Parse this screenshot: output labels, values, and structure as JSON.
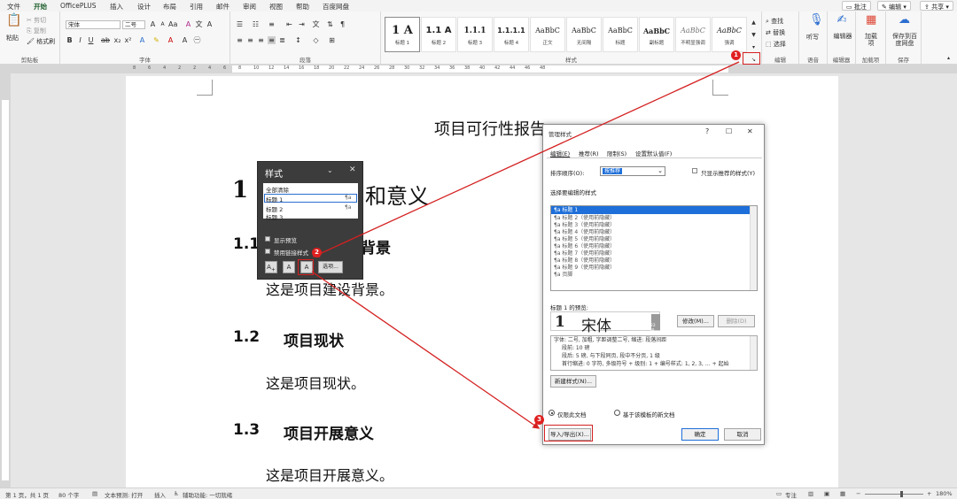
{
  "menubar": {
    "tabs": [
      "文件",
      "开始",
      "OfficePLUS",
      "插入",
      "设计",
      "布局",
      "引用",
      "邮件",
      "审阅",
      "视图",
      "帮助",
      "百度网盘"
    ],
    "active_tab": "开始",
    "annotate_label": "批注",
    "edit_label": "编辑",
    "share_label": "共享"
  },
  "ribbon": {
    "clipboard": {
      "paste": "粘贴",
      "cut": "剪切",
      "copy": "复制",
      "format_painter": "格式刷",
      "label": "剪贴板"
    },
    "font": {
      "name": "宋体",
      "size": "二号",
      "label": "字体"
    },
    "paragraph": {
      "label": "段落"
    },
    "styles": {
      "label": "样式",
      "items": [
        {
          "preview": "1 A",
          "name": "标题 1"
        },
        {
          "preview": "1.1 A",
          "name": "标题 2"
        },
        {
          "preview": "1.1.1",
          "name": "标题 3"
        },
        {
          "preview": "1.1.1.1",
          "name": "标题 4"
        },
        {
          "preview": "AaBbC",
          "name": "正文"
        },
        {
          "preview": "AaBbC",
          "name": "无间隔"
        },
        {
          "preview": "AaBbC",
          "name": "标题"
        },
        {
          "preview": "AaBbC",
          "name": "副标题"
        },
        {
          "preview": "AaBbC",
          "name": "不明显强调"
        },
        {
          "preview": "AaBbC",
          "name": "强调"
        }
      ]
    },
    "editing": {
      "find": "查找",
      "replace": "替换",
      "select": "选择",
      "label": "编辑"
    },
    "voice": {
      "dictate": "听写",
      "label": "语音"
    },
    "editor": {
      "btn": "编辑器",
      "label": "编辑器"
    },
    "addins": {
      "btn": "加载项",
      "label": "加载项"
    },
    "save": {
      "btn": "保存到百度网盘",
      "label": "保存"
    }
  },
  "ruler": {
    "ticks": [
      "8",
      "6",
      "4",
      "2",
      "2",
      "4",
      "6",
      "8",
      "10",
      "12",
      "14",
      "16",
      "18",
      "20",
      "22",
      "24",
      "26",
      "28",
      "30",
      "32",
      "34",
      "36",
      "38",
      "40",
      "42",
      "44",
      "46",
      "48"
    ]
  },
  "document": {
    "title": "项目可行性报告",
    "h1_num": "1",
    "h1_text": "和意义",
    "h2_1_num": "1.1",
    "h2_1_text": "背景",
    "p1": "这是项目建设背景。",
    "h2_2_num": "1.2",
    "h2_2_text": "项目现状",
    "p2": "这是项目现状。",
    "h2_3_num": "1.3",
    "h2_3_text": "项目开展意义",
    "p3": "这是项目开展意义。"
  },
  "styles_pane": {
    "title": "样式",
    "items": [
      "全部清除",
      "标题 1",
      "标题 2",
      "标题 3"
    ],
    "show_preview": "显示预览",
    "disable_linked": "禁用链接样式",
    "options": "选项..."
  },
  "dialog": {
    "title": "管理样式",
    "tabs": [
      "编辑(E)",
      "推荐(R)",
      "限制(S)",
      "设置默认值(F)"
    ],
    "sort_label": "排序顺序(O):",
    "sort_value": "按推荐",
    "only_recommended": "只显示推荐的样式(Y)",
    "select_label": "选择要编辑的样式",
    "styles": [
      "标题 1",
      "标题 2（使用前隐藏）",
      "标题 3（使用前隐藏）",
      "标题 4（使用前隐藏）",
      "标题 5（使用前隐藏）",
      "标题 6（使用前隐藏）",
      "标题 7（使用前隐藏）",
      "标题 8（使用前隐藏）",
      "标题 9（使用前隐藏）",
      "页脚"
    ],
    "preview_label": "标题 1 的预览:",
    "preview_num": "1",
    "preview_font": "宋体",
    "preview_size": "22 磅",
    "modify": "修改(M)...",
    "delete": "删除(D)",
    "desc": [
      "字体: 二号, 加粗, 字距调整二号, 缩进: 段落间距",
      "段前: 10 磅",
      "段后: 5 磅, 与下段同页, 段中不分页, 1 级",
      "首行缩进: 0 字符, 多级符号 + 级别: 1 + 编号样式: 1, 2, 3, … + 起始"
    ],
    "new_style": "新建样式(N)...",
    "radio_doc": "仅限此文档",
    "radio_template": "基于该模板的新文档",
    "import_export": "导入/导出(X)...",
    "ok": "确定",
    "cancel": "取消"
  },
  "callouts": [
    "1",
    "2",
    "3"
  ],
  "status": {
    "page": "第 1 页，共 1 页",
    "words": "80 个字",
    "predict": "文本预测: 打开",
    "insert": "插入",
    "access": "辅助功能: 一切就绪",
    "focus": "专注",
    "zoom": "180%"
  },
  "colors": {
    "accent": "#2b7a3e",
    "callout": "#e02020",
    "selection": "#1e6fd9"
  }
}
